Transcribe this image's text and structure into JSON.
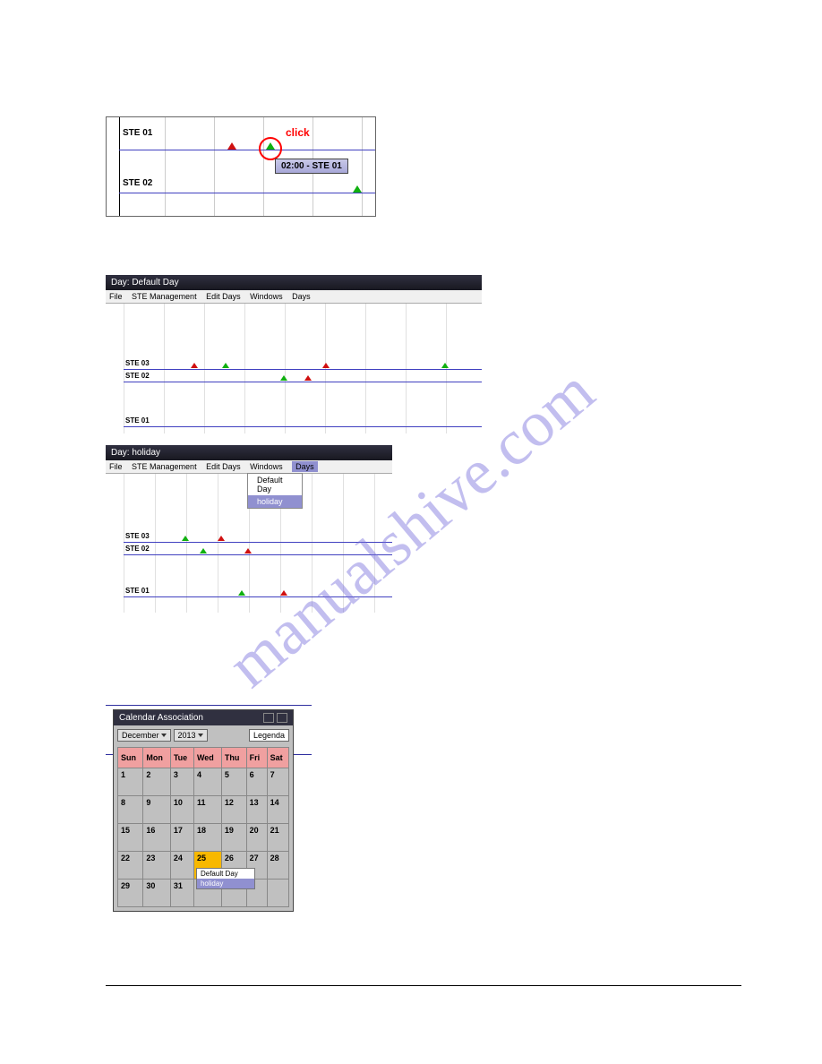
{
  "watermark": "manualshive.com",
  "panel1": {
    "rows": [
      "STE 01",
      "STE 02"
    ],
    "click_label": "click",
    "tooltip": "02:00 - STE 01"
  },
  "panel2": {
    "title": "Day: Default Day",
    "menu": [
      "File",
      "STE Management",
      "Edit Days",
      "Windows",
      "Days"
    ],
    "rows": [
      "STE 03",
      "STE 02",
      "STE 01"
    ]
  },
  "panel3": {
    "title": "Day: holiday",
    "menu": [
      "File",
      "STE Management",
      "Edit Days",
      "Windows",
      "Days"
    ],
    "rows": [
      "STE 03",
      "STE 02",
      "STE 01"
    ],
    "dropdown": [
      "Default Day",
      "holiday"
    ]
  },
  "panel4": {
    "title": "Calendar Association",
    "month": "December",
    "year": "2013",
    "legend": "Legenda",
    "days": [
      "Sun",
      "Mon",
      "Tue",
      "Wed",
      "Thu",
      "Fri",
      "Sat"
    ],
    "weeks": [
      [
        "1",
        "2",
        "3",
        "4",
        "5",
        "6",
        "7"
      ],
      [
        "8",
        "9",
        "10",
        "11",
        "12",
        "13",
        "14"
      ],
      [
        "15",
        "16",
        "17",
        "18",
        "19",
        "20",
        "21"
      ],
      [
        "22",
        "23",
        "24",
        "25",
        "26",
        "27",
        "28"
      ],
      [
        "29",
        "30",
        "31",
        "",
        "",
        "",
        ""
      ]
    ],
    "selected": "25",
    "ctx": [
      "Default Day",
      "holiday"
    ]
  }
}
